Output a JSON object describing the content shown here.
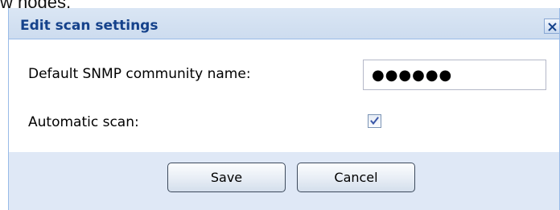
{
  "background": {
    "partial_text": "w nodes."
  },
  "dialog": {
    "title": "Edit scan settings",
    "fields": {
      "community_label": "Default SNMP community name:",
      "community_value": "●●●●●●",
      "automatic_scan_label": "Automatic scan:",
      "automatic_scan_checked": true
    },
    "buttons": {
      "save": "Save",
      "cancel": "Cancel"
    }
  },
  "colors": {
    "title_text": "#15428b",
    "frame_border": "#99bbe8",
    "footer_bg": "#dfe8f6"
  },
  "icons": {
    "close": "close-icon",
    "check": "checkmark-icon"
  }
}
